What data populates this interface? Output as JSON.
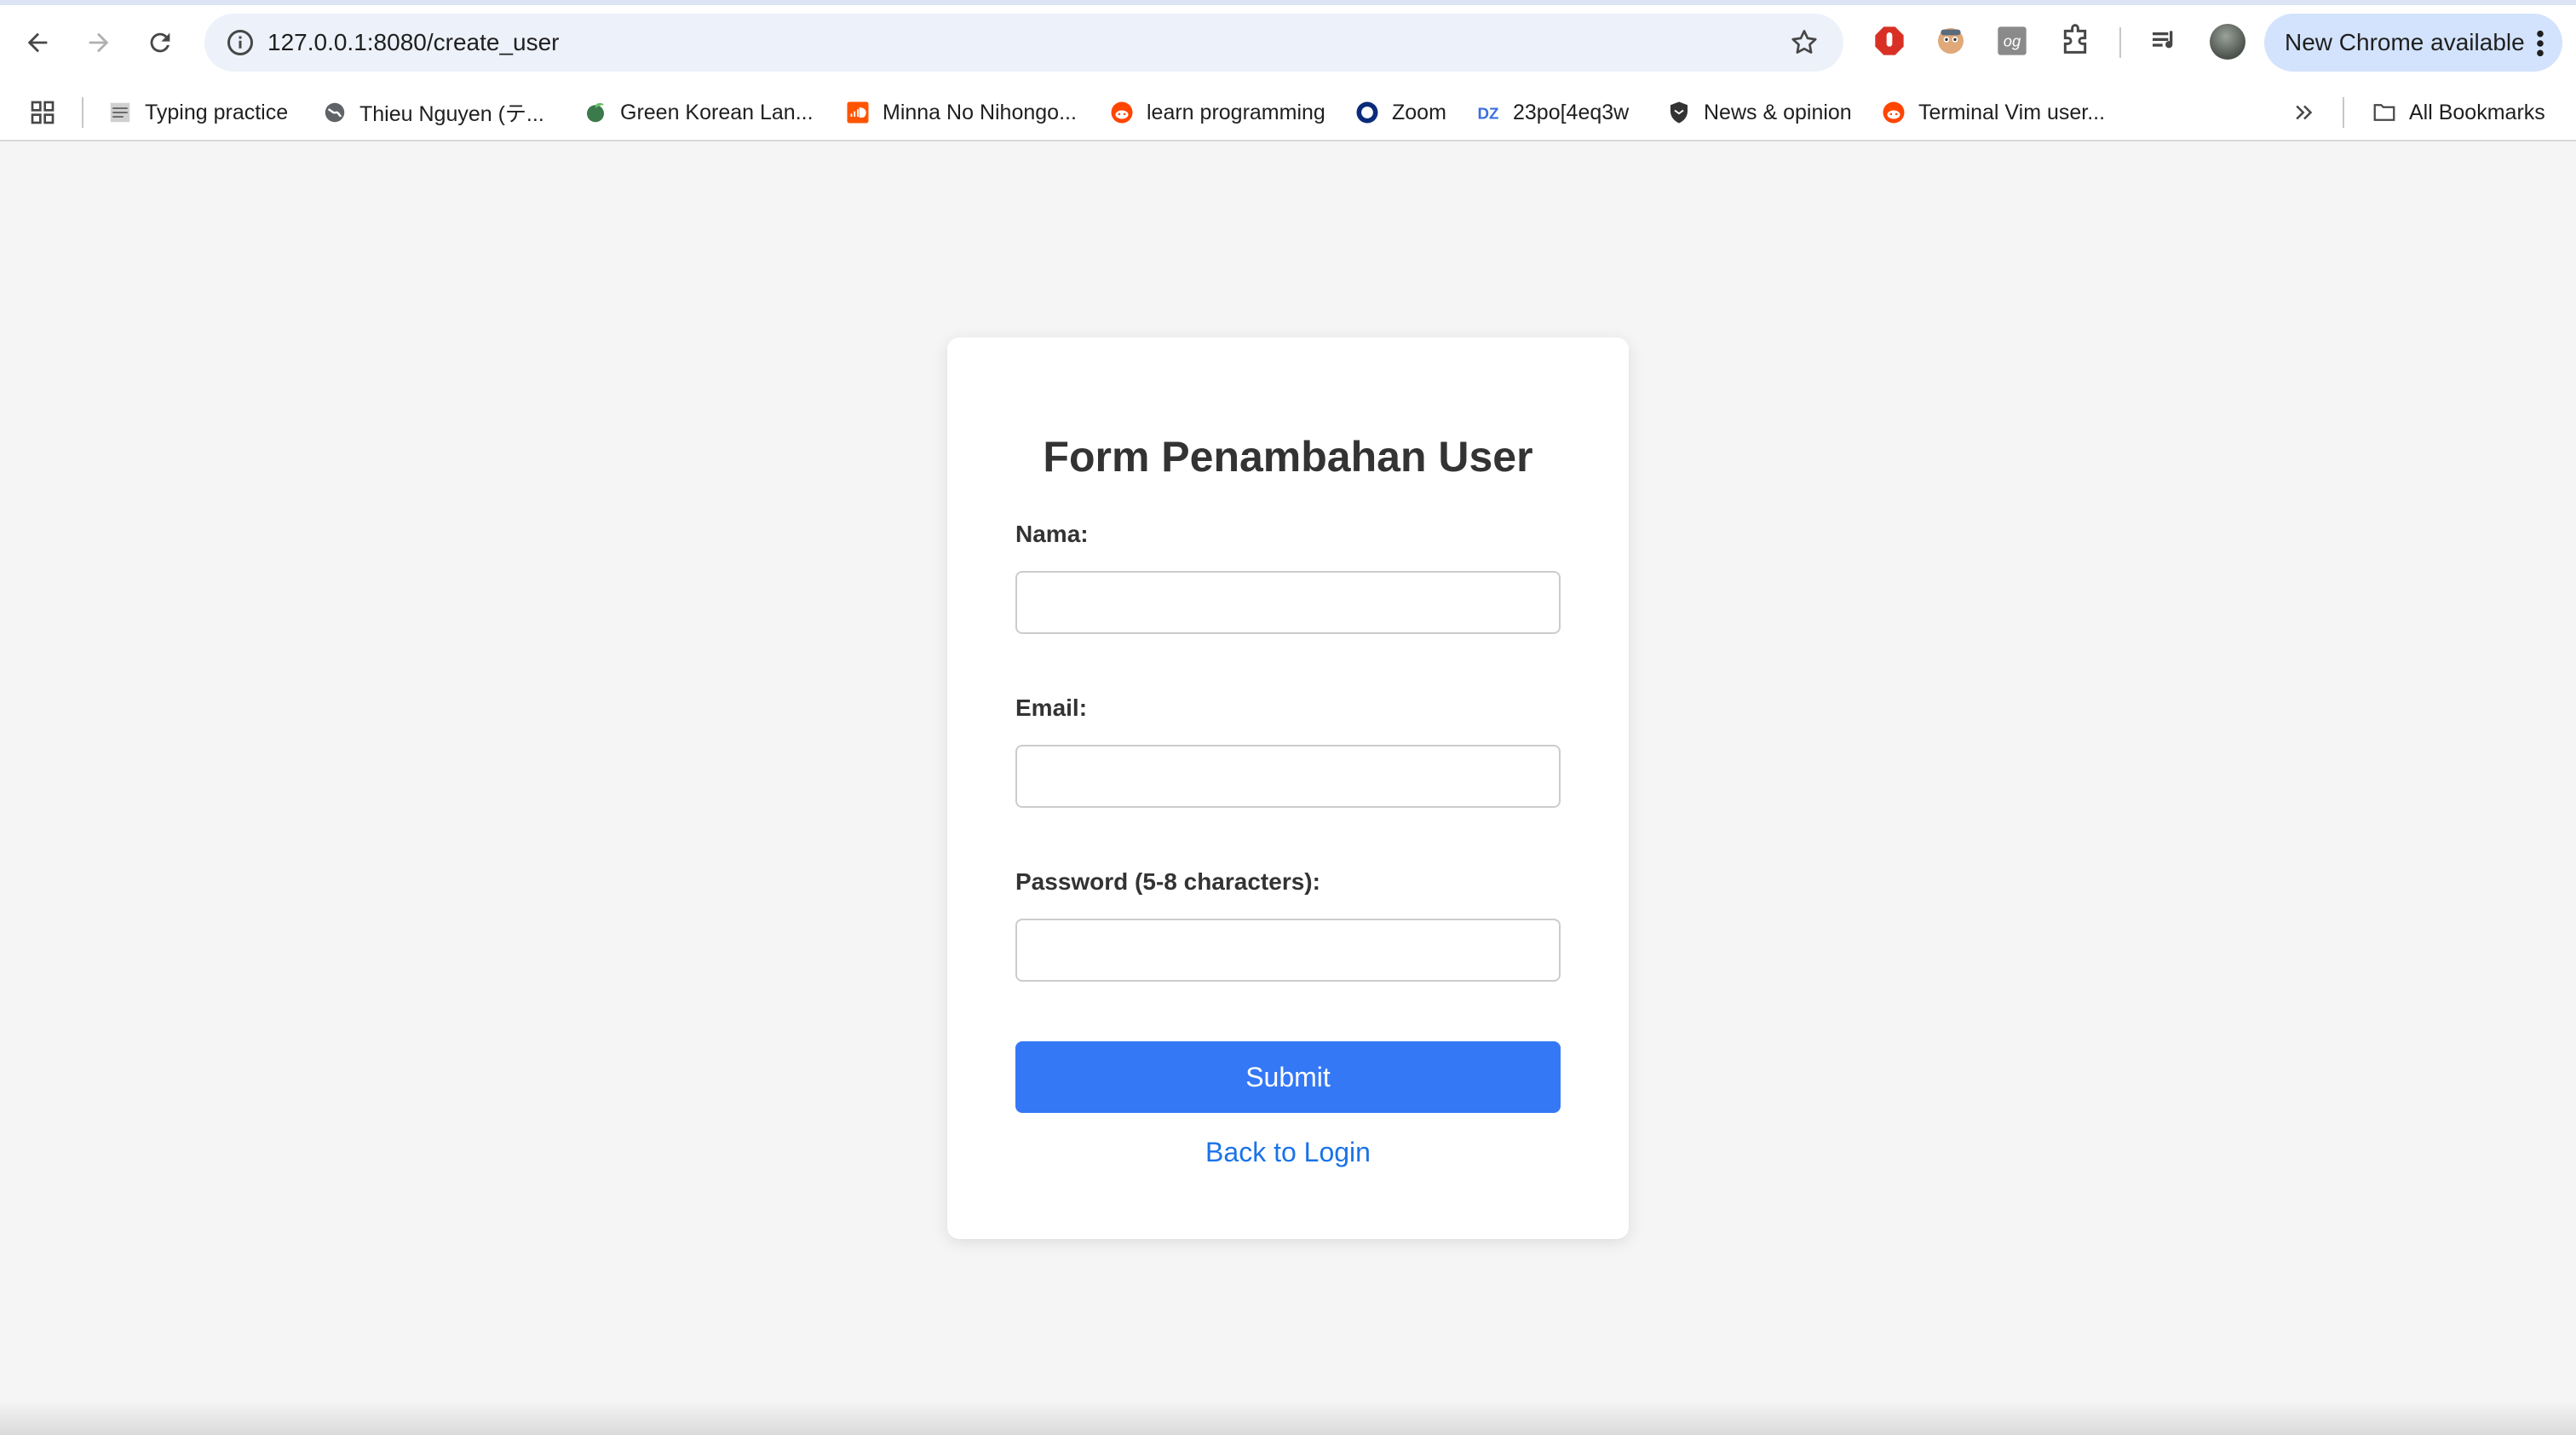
{
  "browser": {
    "url": "127.0.0.1:8080/create_user",
    "update_label": "New Chrome available"
  },
  "bookmarks": [
    {
      "label": "Typing practice",
      "icon": "typing-icon"
    },
    {
      "label": "Thieu Nguyen (テ...",
      "icon": "globe-icon"
    },
    {
      "label": "Green Korean Lan...",
      "icon": "leaf-icon"
    },
    {
      "label": "Minna No Nihongo...",
      "icon": "soundcloud-icon"
    },
    {
      "label": "learn programming",
      "icon": "reddit-icon"
    },
    {
      "label": "Zoom",
      "icon": "zoom-icon"
    },
    {
      "label": "23po[4eq3w",
      "icon": "dz-icon"
    },
    {
      "label": "News & opinion",
      "icon": "shield-icon"
    },
    {
      "label": "Terminal Vim user...",
      "icon": "reddit-icon"
    }
  ],
  "all_bookmarks_label": "All Bookmarks",
  "form": {
    "title": "Form Penambahan User",
    "name_label": "Nama:",
    "name_value": "",
    "email_label": "Email:",
    "email_value": "",
    "password_label": "Password (5-8 characters):",
    "password_value": "",
    "submit_label": "Submit",
    "back_label": "Back to Login"
  },
  "colors": {
    "accent": "#3478f6",
    "link": "#1a73e8",
    "page_bg": "#f5f5f5"
  }
}
